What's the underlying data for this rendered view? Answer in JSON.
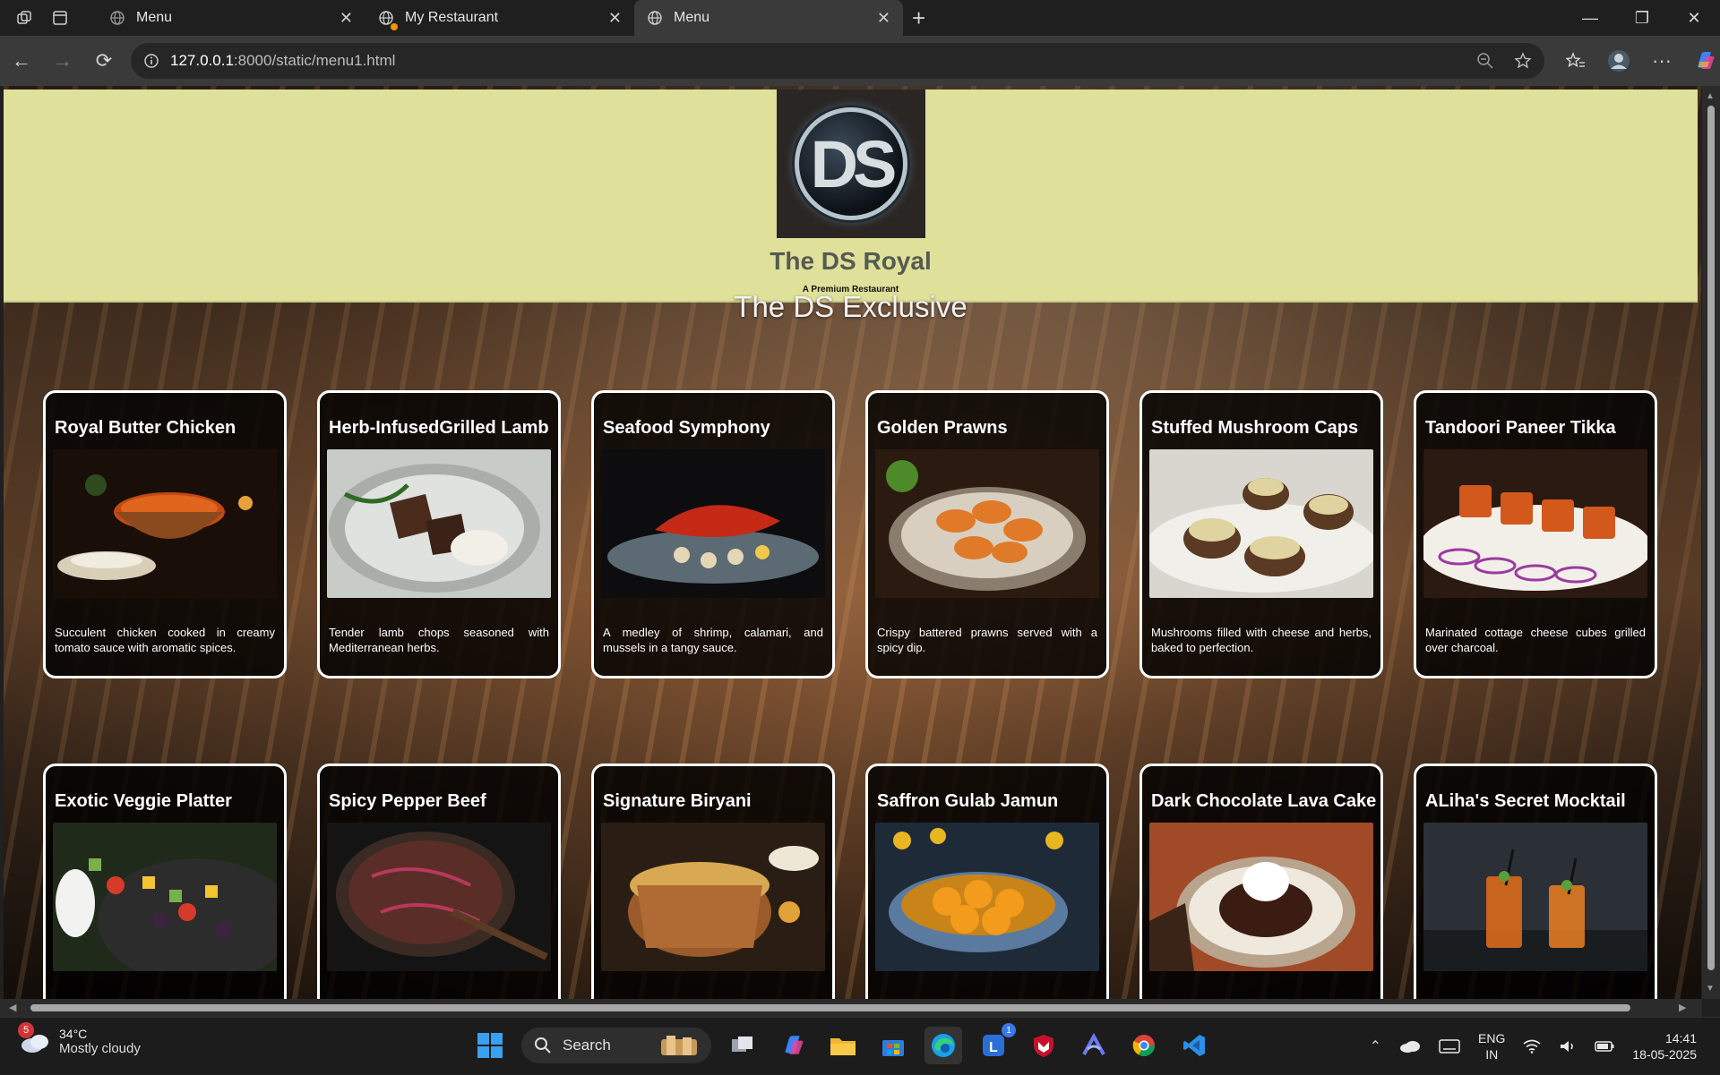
{
  "browser": {
    "tabs": [
      {
        "title": "Menu",
        "active": false
      },
      {
        "title": "My Restaurant",
        "active": false
      },
      {
        "title": "Menu",
        "active": true
      }
    ],
    "url": {
      "host": "127.0.0.1",
      "path": ":8000/static/menu1.html"
    }
  },
  "header": {
    "logo_text": "DS",
    "brand": "The DS Royal",
    "tagline": "A Premium Restaurant"
  },
  "section_title": "The DS Exclusive",
  "menu_items": [
    {
      "name": "Royal Butter Chicken",
      "description": "Succulent chicken cooked in creamy tomato sauce with aromatic spices."
    },
    {
      "name": "Herb-InfusedGrilled Lamb",
      "description": "Tender lamb chops seasoned with Mediterranean herbs."
    },
    {
      "name": "Seafood Symphony",
      "description": "A medley of shrimp, calamari, and mussels in a tangy sauce."
    },
    {
      "name": "Golden Prawns",
      "description": "Crispy battered prawns served with a spicy dip."
    },
    {
      "name": "Stuffed Mushroom Caps",
      "description": "Mushrooms filled with cheese and herbs, baked to perfection."
    },
    {
      "name": "Tandoori Paneer Tikka",
      "description": "Marinated cottage cheese cubes grilled over charcoal."
    },
    {
      "name": "Exotic Veggie Platter",
      "description": ""
    },
    {
      "name": "Spicy Pepper Beef",
      "description": ""
    },
    {
      "name": "Signature Biryani",
      "description": ""
    },
    {
      "name": "Saffron Gulab Jamun",
      "description": ""
    },
    {
      "name": "Dark Chocolate Lava Cake",
      "description": ""
    },
    {
      "name": "ALiha's Secret Mocktail",
      "description": ""
    }
  ],
  "taskbar": {
    "weather": {
      "badge": "5",
      "temp": "34°C",
      "condition": "Mostly cloudy"
    },
    "search_label": "Search",
    "notification_count": "1",
    "lang_top": "ENG",
    "lang_bottom": "IN",
    "time": "14:41",
    "date": "18-05-2025"
  }
}
